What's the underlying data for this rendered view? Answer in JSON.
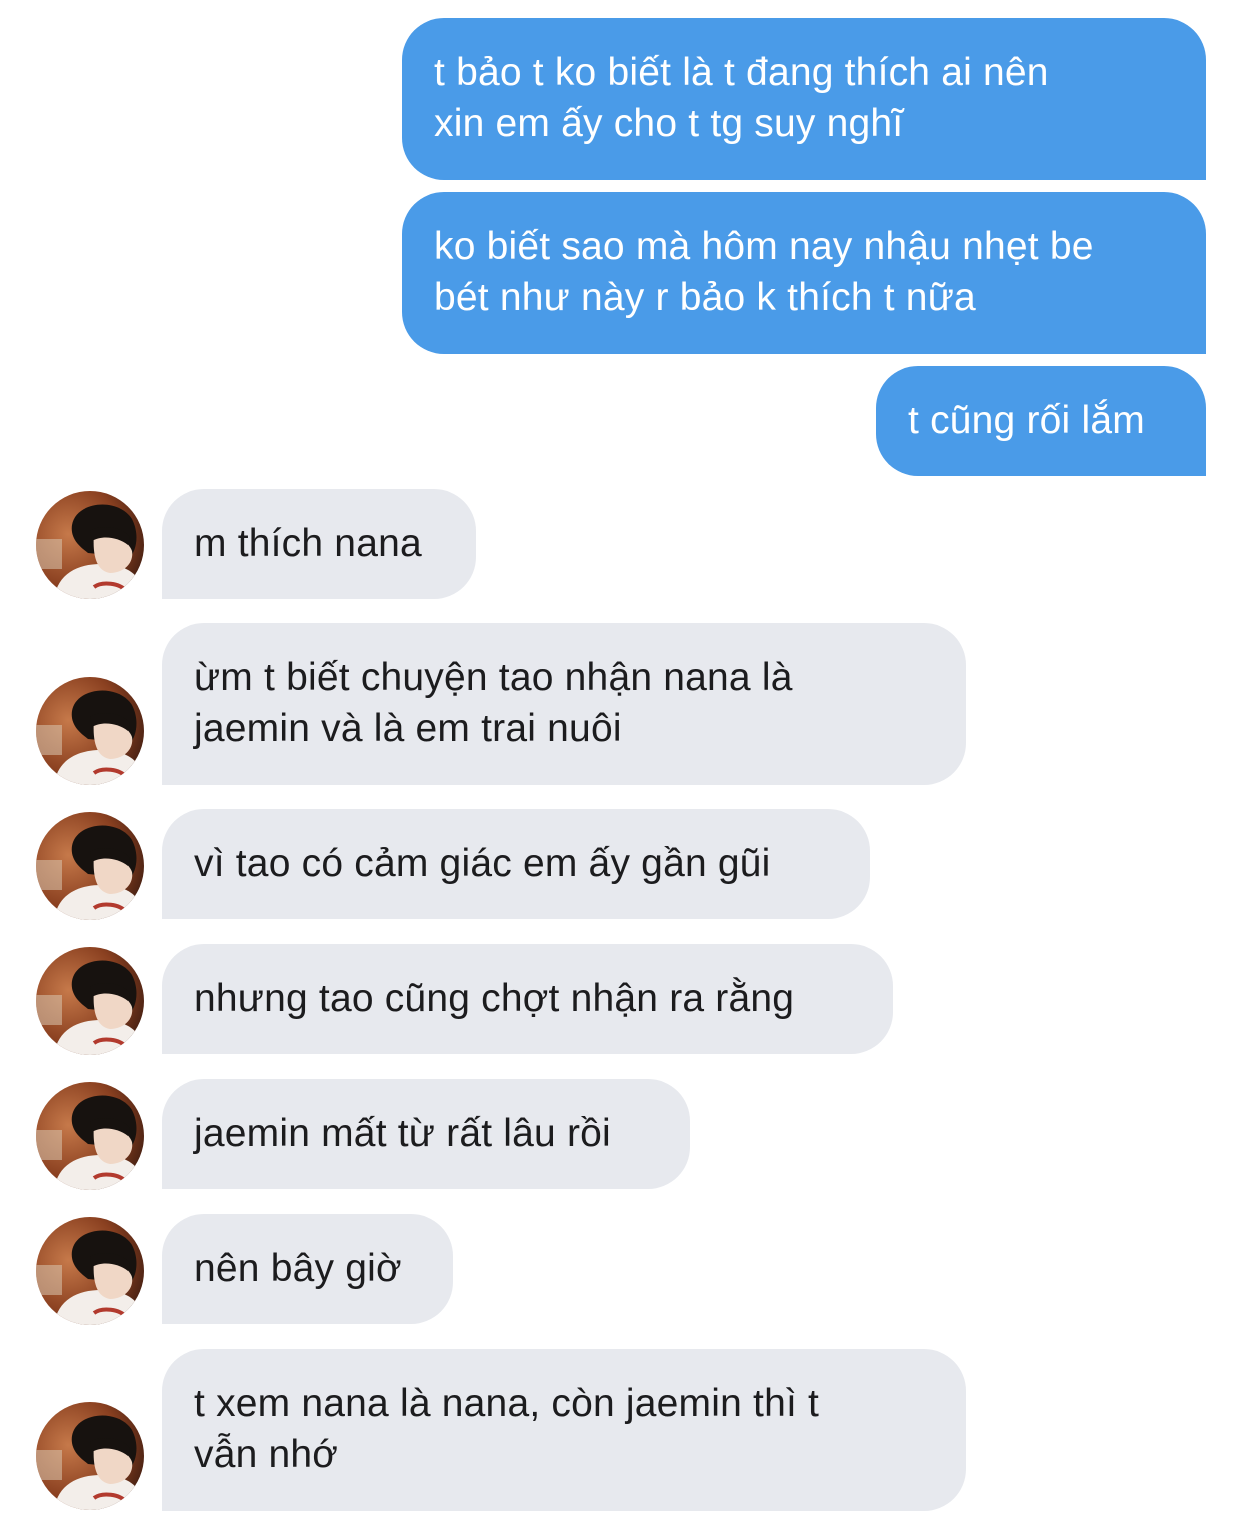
{
  "conversation": {
    "sent": [
      "t bảo t ko biết là t đang thích ai nên\nxin em ấy cho t tg suy nghĩ",
      "ko biết sao mà hôm nay nhậu nhẹt be\nbét như này r bảo k thích t nữa",
      "t cũng rối lắm"
    ],
    "received": [
      "m thích nana",
      "ừm t biết chuyện tao nhận nana là\njaemin và là em trai nuôi",
      "vì tao có cảm giác em ấy gần gũi",
      "nhưng tao cũng chợt nhận ra rằng",
      "jaemin mất từ rất lâu rồi",
      "nên bây giờ",
      "t xem nana là nana, còn jaemin thì t\nvẫn nhớ"
    ]
  },
  "colors": {
    "sent_bubble": "#4a9be8",
    "received_bubble": "#e7e9ee",
    "sent_text": "#ffffff",
    "received_text": "#1c1c1e"
  },
  "avatar_icon": "profile-photo-avatar"
}
